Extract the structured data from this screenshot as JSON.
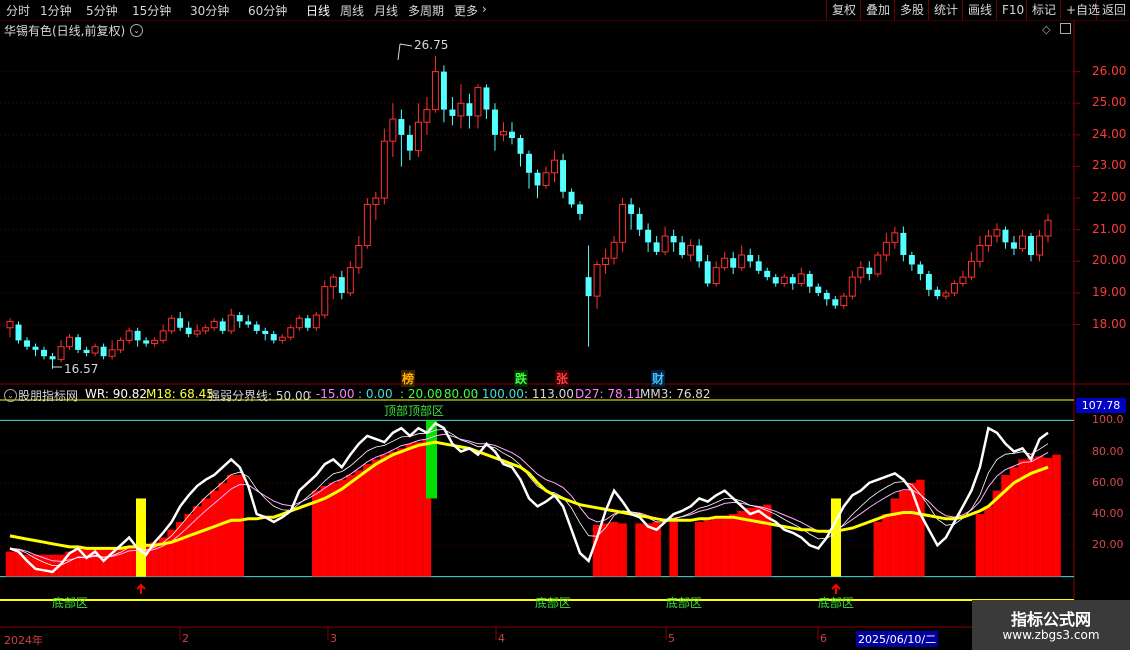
{
  "toolbar": {
    "periods": [
      "分时",
      "1分钟",
      "5分钟",
      "15分钟",
      "30分钟",
      "60分钟",
      "日线",
      "周线",
      "月线",
      "多周期",
      "更多"
    ],
    "active_period": "日线",
    "right_buttons": [
      "复权",
      "叠加",
      "多股",
      "统计",
      "画线",
      "F10",
      "标记",
      "+自选",
      "返回"
    ]
  },
  "stock_title": "华锡有色(日线,前复权)",
  "upper_axis": [
    "26.00",
    "25.00",
    "24.00",
    "23.00",
    "22.00",
    "21.00",
    "20.00",
    "19.00",
    "18.00"
  ],
  "price_annotations": {
    "high": "26.75",
    "low": "16.57"
  },
  "event_marks": [
    "榜",
    "跌",
    "张",
    "财"
  ],
  "indicator": {
    "name": "股朋指标网",
    "wr": "WR: 90.82",
    "m18": "M18: 68.45",
    "boundary_label": "强弱分界线: 50.00",
    "levels": [
      ": -15.00",
      ": 0.00",
      ": 20.00",
      ": 80.00",
      ": 100.00",
      ": 113.00"
    ],
    "d27": "D27: 78.11",
    "mm3": "MM3: 76.82",
    "current_value": "107.78"
  },
  "lower_axis": [
    "100.0",
    "80.00",
    "60.00",
    "40.00",
    "20.00"
  ],
  "zone_labels": {
    "top": "顶部顶部区",
    "bottom": "底部区"
  },
  "date_axis": [
    "2024年",
    "2",
    "3",
    "4",
    "5",
    "6"
  ],
  "cursor_date": "2025/06/10/二",
  "watermark": {
    "title": "指标公式网",
    "url": "www.zbgs3.com"
  },
  "colors": {
    "up": "#ff3030",
    "down": "#54ffff",
    "wr_line": "#ffffff",
    "m18_line": "#ffff00",
    "bars": "#ff0000"
  },
  "chart_data": {
    "type": "candlestick",
    "price_range": [
      16.5,
      27.0
    ],
    "candles": [
      [
        17.9,
        18.1,
        17.6,
        18.2
      ],
      [
        18.0,
        17.5,
        17.4,
        18.1
      ],
      [
        17.5,
        17.3,
        17.2,
        17.6
      ],
      [
        17.3,
        17.2,
        17.0,
        17.4
      ],
      [
        17.2,
        17.0,
        16.9,
        17.3
      ],
      [
        17.0,
        16.9,
        16.6,
        17.1
      ],
      [
        16.9,
        17.3,
        16.8,
        17.5
      ],
      [
        17.3,
        17.6,
        17.2,
        17.7
      ],
      [
        17.6,
        17.2,
        17.1,
        17.7
      ],
      [
        17.2,
        17.1,
        17.0,
        17.3
      ],
      [
        17.1,
        17.3,
        17.0,
        17.4
      ],
      [
        17.3,
        17.0,
        16.9,
        17.4
      ],
      [
        17.0,
        17.2,
        16.9,
        17.5
      ],
      [
        17.2,
        17.5,
        17.1,
        17.6
      ],
      [
        17.5,
        17.8,
        17.4,
        17.9
      ],
      [
        17.8,
        17.5,
        17.3,
        17.9
      ],
      [
        17.5,
        17.4,
        17.3,
        17.6
      ],
      [
        17.4,
        17.5,
        17.3,
        17.6
      ],
      [
        17.5,
        17.8,
        17.4,
        18.0
      ],
      [
        17.8,
        18.2,
        17.7,
        18.3
      ],
      [
        18.2,
        17.9,
        17.8,
        18.4
      ],
      [
        17.9,
        17.7,
        17.6,
        18.1
      ],
      [
        17.7,
        17.8,
        17.6,
        18.0
      ],
      [
        17.8,
        17.9,
        17.7,
        18.0
      ],
      [
        17.9,
        18.1,
        17.8,
        18.2
      ],
      [
        18.1,
        17.8,
        17.7,
        18.2
      ],
      [
        17.8,
        18.3,
        17.7,
        18.5
      ],
      [
        18.3,
        18.1,
        17.9,
        18.4
      ],
      [
        18.1,
        18.0,
        17.9,
        18.3
      ],
      [
        18.0,
        17.8,
        17.7,
        18.1
      ],
      [
        17.8,
        17.7,
        17.5,
        17.9
      ],
      [
        17.7,
        17.5,
        17.4,
        17.8
      ],
      [
        17.5,
        17.6,
        17.4,
        17.7
      ],
      [
        17.6,
        17.9,
        17.5,
        18.0
      ],
      [
        17.9,
        18.2,
        17.8,
        18.3
      ],
      [
        18.2,
        17.9,
        17.8,
        18.3
      ],
      [
        17.9,
        18.3,
        17.8,
        18.4
      ],
      [
        18.3,
        19.2,
        18.2,
        19.4
      ],
      [
        19.2,
        19.5,
        18.8,
        19.6
      ],
      [
        19.5,
        19.0,
        18.8,
        19.7
      ],
      [
        19.0,
        19.8,
        18.9,
        20.0
      ],
      [
        19.8,
        20.5,
        19.6,
        20.8
      ],
      [
        20.5,
        21.8,
        20.4,
        22.0
      ],
      [
        21.8,
        22.0,
        21.3,
        22.2
      ],
      [
        22.0,
        23.8,
        21.8,
        24.2
      ],
      [
        23.8,
        24.5,
        23.3,
        25.0
      ],
      [
        24.5,
        24.0,
        23.0,
        24.8
      ],
      [
        24.0,
        23.5,
        23.2,
        24.3
      ],
      [
        23.5,
        24.4,
        23.3,
        25.0
      ],
      [
        24.4,
        24.8,
        24.0,
        25.2
      ],
      [
        24.8,
        26.0,
        24.7,
        26.5
      ],
      [
        26.0,
        24.8,
        24.4,
        26.2
      ],
      [
        24.8,
        24.6,
        24.3,
        25.2
      ],
      [
        24.6,
        25.0,
        24.2,
        25.6
      ],
      [
        25.0,
        24.6,
        24.2,
        25.3
      ],
      [
        24.6,
        25.5,
        24.2,
        25.6
      ],
      [
        25.5,
        24.8,
        24.5,
        25.6
      ],
      [
        24.8,
        24.0,
        23.5,
        25.0
      ],
      [
        24.0,
        24.1,
        23.8,
        24.4
      ],
      [
        24.1,
        23.9,
        23.7,
        24.4
      ],
      [
        23.9,
        23.4,
        23.0,
        24.0
      ],
      [
        23.4,
        22.8,
        22.3,
        23.5
      ],
      [
        22.8,
        22.4,
        22.0,
        22.9
      ],
      [
        22.4,
        22.8,
        22.3,
        23.0
      ],
      [
        22.8,
        23.2,
        22.5,
        23.5
      ],
      [
        23.2,
        22.2,
        22.0,
        23.4
      ],
      [
        22.2,
        21.8,
        21.7,
        22.3
      ],
      [
        21.8,
        21.5,
        21.3,
        21.9
      ],
      [
        19.5,
        18.9,
        17.3,
        20.5
      ],
      [
        18.9,
        19.9,
        18.5,
        20.0
      ],
      [
        19.9,
        20.1,
        19.6,
        20.4
      ],
      [
        20.1,
        20.6,
        19.9,
        20.8
      ],
      [
        20.6,
        21.8,
        20.3,
        22.0
      ],
      [
        21.8,
        21.5,
        21.0,
        22.0
      ],
      [
        21.5,
        21.0,
        20.8,
        21.7
      ],
      [
        21.0,
        20.6,
        20.3,
        21.2
      ],
      [
        20.6,
        20.3,
        20.2,
        20.8
      ],
      [
        20.3,
        20.8,
        20.2,
        21.1
      ],
      [
        20.8,
        20.6,
        20.3,
        21.0
      ],
      [
        20.6,
        20.2,
        20.1,
        20.8
      ],
      [
        20.2,
        20.5,
        20.0,
        20.7
      ],
      [
        20.5,
        20.0,
        19.8,
        20.7
      ],
      [
        20.0,
        19.3,
        19.2,
        20.2
      ],
      [
        19.3,
        19.8,
        19.2,
        20.0
      ],
      [
        19.8,
        20.1,
        19.7,
        20.3
      ],
      [
        20.1,
        19.8,
        19.6,
        20.3
      ],
      [
        19.8,
        20.2,
        19.7,
        20.5
      ],
      [
        20.2,
        20.0,
        19.8,
        20.4
      ],
      [
        20.0,
        19.7,
        19.6,
        20.2
      ],
      [
        19.7,
        19.5,
        19.4,
        19.8
      ],
      [
        19.5,
        19.3,
        19.2,
        19.6
      ],
      [
        19.3,
        19.5,
        19.2,
        19.6
      ],
      [
        19.5,
        19.3,
        19.1,
        19.6
      ],
      [
        19.3,
        19.6,
        19.2,
        19.8
      ],
      [
        19.6,
        19.2,
        19.0,
        19.7
      ],
      [
        19.2,
        19.0,
        18.9,
        19.3
      ],
      [
        19.0,
        18.8,
        18.6,
        19.1
      ],
      [
        18.8,
        18.6,
        18.5,
        18.9
      ],
      [
        18.6,
        18.9,
        18.5,
        19.0
      ],
      [
        18.9,
        19.5,
        18.8,
        19.7
      ],
      [
        19.5,
        19.8,
        19.3,
        20.0
      ],
      [
        19.8,
        19.6,
        19.4,
        20.0
      ],
      [
        19.6,
        20.2,
        19.5,
        20.3
      ],
      [
        20.2,
        20.6,
        20.0,
        20.9
      ],
      [
        20.6,
        20.9,
        20.4,
        21.1
      ],
      [
        20.9,
        20.2,
        20.0,
        21.1
      ],
      [
        20.2,
        19.9,
        19.7,
        20.3
      ],
      [
        19.9,
        19.6,
        19.4,
        20.0
      ],
      [
        19.6,
        19.1,
        18.9,
        19.7
      ],
      [
        19.1,
        18.9,
        18.8,
        19.2
      ],
      [
        18.9,
        19.0,
        18.8,
        19.1
      ],
      [
        19.0,
        19.3,
        18.9,
        19.4
      ],
      [
        19.3,
        19.5,
        19.2,
        19.7
      ],
      [
        19.5,
        20.0,
        19.4,
        20.3
      ],
      [
        20.0,
        20.5,
        19.8,
        20.8
      ],
      [
        20.5,
        20.8,
        20.3,
        21.0
      ],
      [
        20.8,
        21.0,
        20.6,
        21.2
      ],
      [
        21.0,
        20.6,
        20.4,
        21.1
      ],
      [
        20.6,
        20.4,
        20.2,
        20.8
      ],
      [
        20.4,
        20.8,
        20.3,
        21.0
      ],
      [
        20.8,
        20.2,
        20.0,
        20.9
      ],
      [
        20.2,
        20.8,
        20.0,
        21.0
      ],
      [
        20.8,
        21.3,
        20.6,
        21.5
      ]
    ],
    "wr_range": [
      -15,
      113
    ],
    "wr": [
      18,
      16,
      10,
      5,
      4,
      3,
      8,
      15,
      18,
      12,
      16,
      10,
      15,
      20,
      25,
      18,
      14,
      22,
      28,
      35,
      45,
      52,
      58,
      62,
      65,
      70,
      75,
      70,
      58,
      40,
      38,
      35,
      38,
      42,
      55,
      60,
      65,
      72,
      75,
      70,
      78,
      85,
      90,
      88,
      86,
      92,
      95,
      90,
      95,
      92,
      98,
      95,
      85,
      80,
      82,
      78,
      85,
      80,
      72,
      70,
      62,
      50,
      45,
      48,
      52,
      45,
      30,
      15,
      10,
      25,
      42,
      55,
      48,
      40,
      38,
      32,
      30,
      35,
      40,
      42,
      45,
      50,
      48,
      52,
      55,
      50,
      45,
      40,
      42,
      38,
      35,
      30,
      28,
      25,
      20,
      18,
      25,
      35,
      45,
      52,
      55,
      60,
      62,
      64,
      66,
      62,
      55,
      40,
      30,
      20,
      25,
      35,
      45,
      55,
      70,
      95,
      92,
      85,
      80,
      82,
      75,
      88,
      92
    ],
    "m18": [
      26,
      25,
      24,
      23,
      22,
      21,
      20,
      19,
      19,
      18,
      18,
      18,
      18,
      18,
      19,
      19,
      20,
      20,
      21,
      22,
      24,
      26,
      28,
      30,
      32,
      34,
      36,
      36,
      37,
      37,
      38,
      38,
      40,
      42,
      44,
      46,
      48,
      50,
      53,
      56,
      60,
      64,
      68,
      72,
      75,
      78,
      80,
      82,
      84,
      85,
      86,
      85,
      84,
      83,
      82,
      80,
      78,
      76,
      74,
      72,
      70,
      66,
      60,
      55,
      52,
      50,
      48,
      46,
      45,
      44,
      43,
      42,
      41,
      40,
      39,
      38,
      37,
      36,
      36,
      36,
      36,
      37,
      37,
      38,
      38,
      38,
      37,
      36,
      35,
      34,
      33,
      32,
      31,
      30,
      30,
      29,
      29,
      29,
      30,
      31,
      33,
      35,
      37,
      39,
      40,
      41,
      41,
      40,
      39,
      38,
      37,
      37,
      38,
      40,
      42,
      45,
      50,
      55,
      60,
      63,
      66,
      68,
      70
    ],
    "bars": [
      16,
      16,
      14,
      14,
      14,
      14,
      14,
      16,
      18,
      18,
      18,
      18,
      18,
      18,
      18,
      18,
      20,
      22,
      25,
      30,
      35,
      40,
      45,
      50,
      55,
      60,
      65,
      65,
      0,
      0,
      0,
      0,
      0,
      0,
      0,
      0,
      55,
      58,
      60,
      62,
      65,
      68,
      72,
      75,
      78,
      80,
      82,
      85,
      86,
      88,
      0,
      0,
      0,
      0,
      0,
      0,
      0,
      0,
      0,
      0,
      0,
      0,
      0,
      0,
      0,
      0,
      0,
      0,
      0,
      33,
      34,
      35,
      34,
      0,
      34,
      34,
      35,
      0,
      35,
      0,
      0,
      35,
      36,
      37,
      38,
      40,
      42,
      44,
      45,
      46,
      0,
      0,
      0,
      0,
      0,
      0,
      0,
      0,
      0,
      0,
      0,
      0,
      35,
      40,
      50,
      55,
      60,
      62,
      0,
      0,
      0,
      0,
      0,
      0,
      40,
      45,
      55,
      65,
      70,
      75,
      76,
      77,
      76,
      78
    ]
  }
}
